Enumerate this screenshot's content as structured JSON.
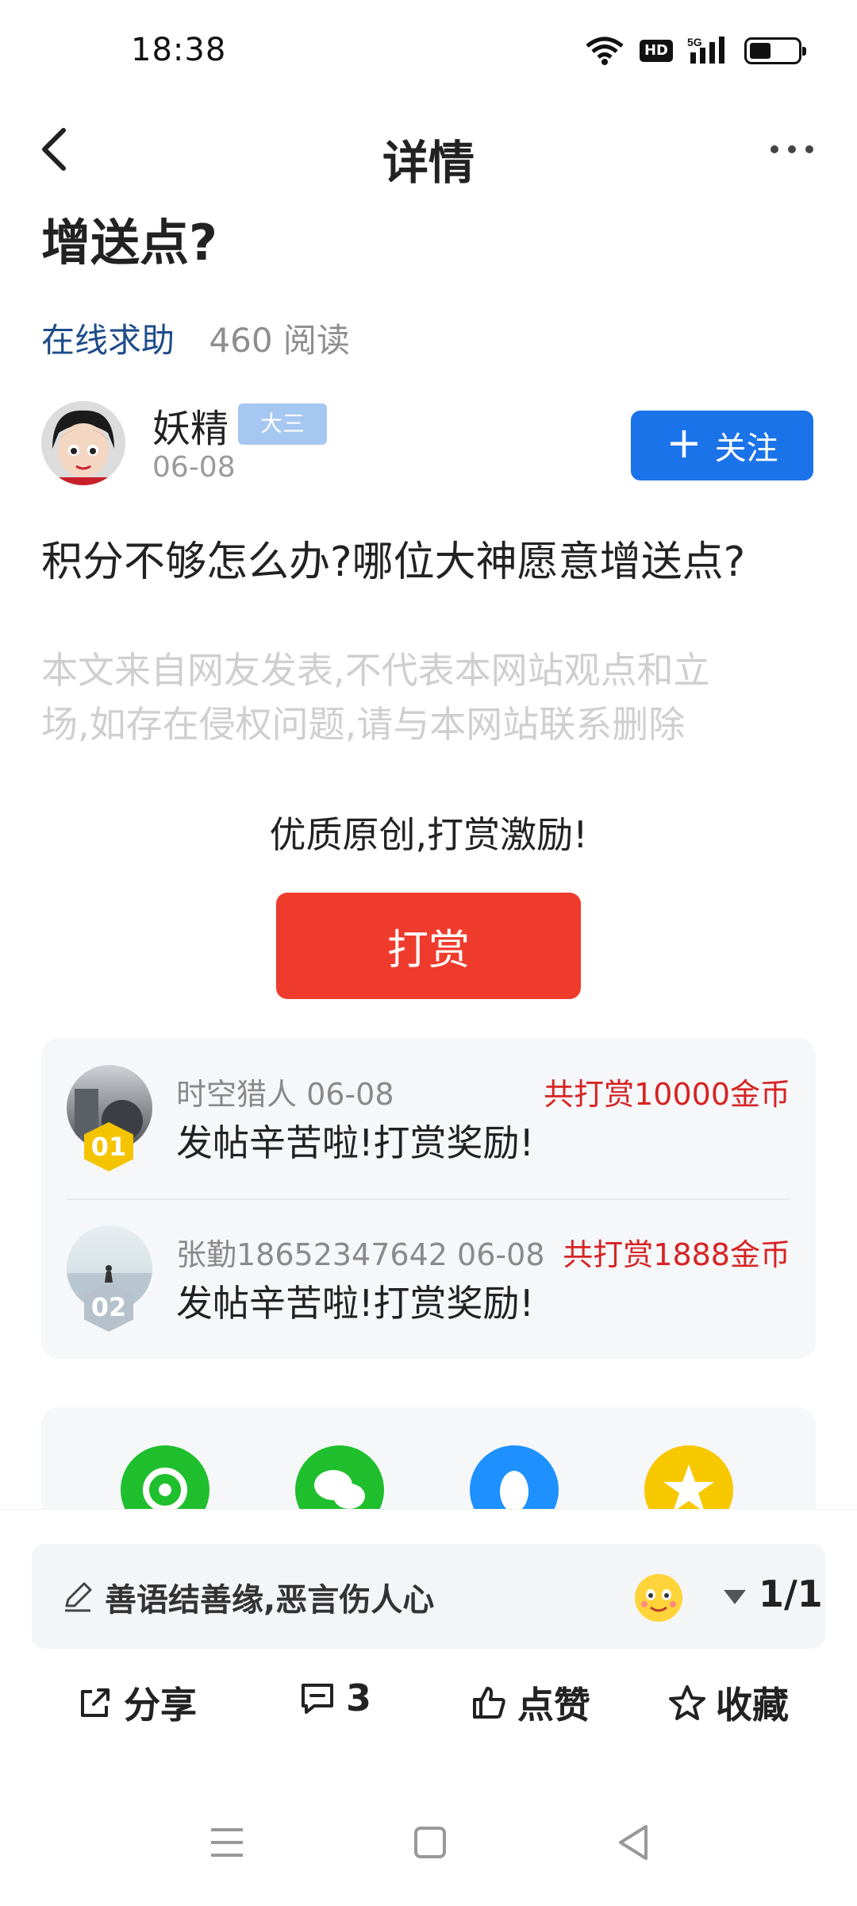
{
  "status_bar": {
    "time": "18:38",
    "hd": "HD",
    "network": "5G"
  },
  "nav": {
    "title": "详情"
  },
  "post": {
    "title": "增送点?",
    "category": "在线求助",
    "reads": "460 阅读",
    "author": {
      "name": "妖精",
      "badge": "大三",
      "date": "06-08"
    },
    "follow_label": "关注",
    "body": "积分不够怎么办?哪位大神愿意增送点?",
    "disclaimer_line1": "本文来自网友发表,不代表本网站观点和立",
    "disclaimer_line2": "场,如存在侵权问题,请与本网站联系删除"
  },
  "reward": {
    "tip": "优质原创,打赏激励!",
    "button_label": "打赏",
    "entries": [
      {
        "rank": "01",
        "name": "时空猎人 06-08",
        "amount": "共打赏10000金币",
        "message": "发帖辛苦啦!打赏奖励!"
      },
      {
        "rank": "02",
        "name": "张勤18652347642 06-08",
        "amount": "共打赏1888金币",
        "message": "发帖辛苦啦!打赏奖励!"
      }
    ]
  },
  "share_icons": [
    "moments-icon",
    "wechat-icon",
    "qq-icon",
    "qzone-icon"
  ],
  "comment": {
    "placeholder": "善语结善缘,恶言伤人心",
    "page": "1/1"
  },
  "actions": {
    "share": "分享",
    "comments": "3",
    "like": "点赞",
    "favorite": "收藏"
  },
  "colors": {
    "accent": "#1a73e8",
    "reward_red": "#ef3b2c",
    "amount_red": "#d62424"
  }
}
